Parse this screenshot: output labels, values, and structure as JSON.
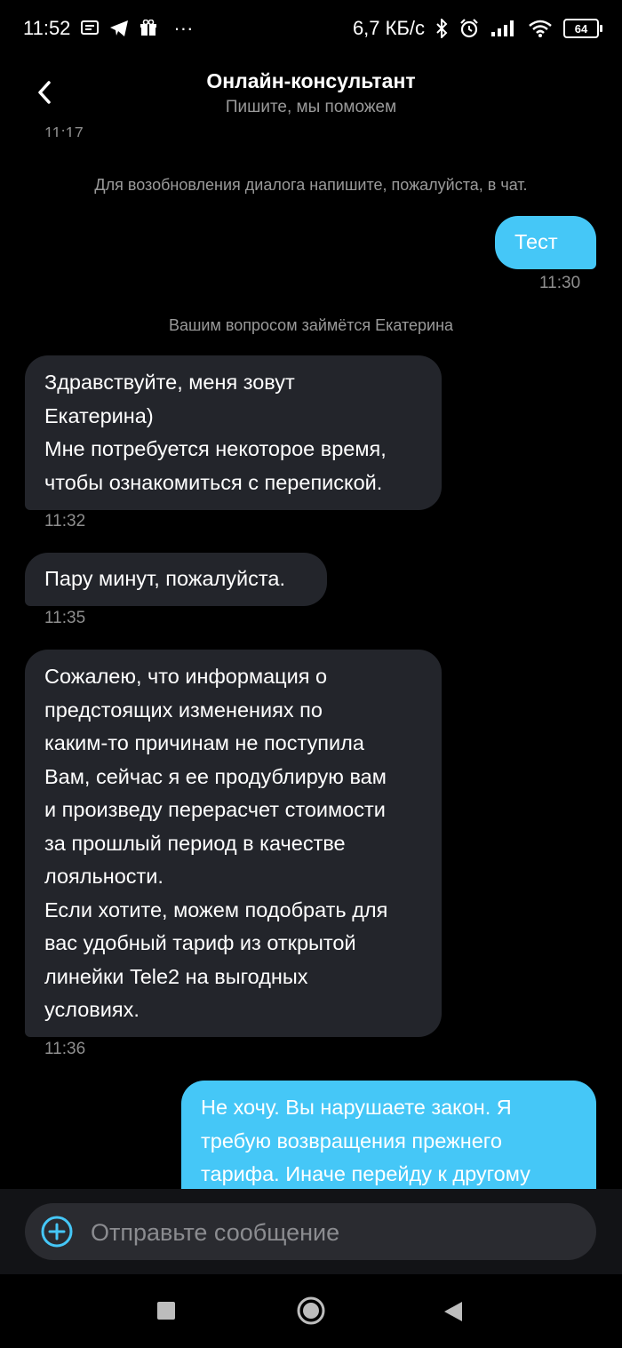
{
  "status_bar": {
    "time": "11:52",
    "more": "···",
    "net_speed": "6,7 КБ/с",
    "battery": "64"
  },
  "header": {
    "title": "Онлайн-консультант",
    "subtitle": "Пишите, мы поможем"
  },
  "chat": {
    "cut_time": "11:17",
    "system_1": "Для возобновления диалога напишите, пожалуйста, в чат.",
    "system_2": "Вашим вопросом займётся Екатерина",
    "messages": [
      {
        "from": "user",
        "text": "Тест",
        "time": "11:30"
      },
      {
        "from": "operator",
        "lines": [
          "Здравствуйте, меня зовут",
          "Екатерина)",
          "Мне потребуется некоторое время,",
          "чтобы ознакомиться с перепиской."
        ],
        "time": "11:32"
      },
      {
        "from": "operator",
        "lines": [
          "Пару минут, пожалуйста."
        ],
        "time": "11:35"
      },
      {
        "from": "operator",
        "lines": [
          "Сожалею, что информация о",
          "предстоящих изменениях по",
          "каким-то причинам не поступила",
          "Вам, сейчас я ее продублирую вам",
          "и произведу перерасчет стоимости",
          "за прошлый период в качестве",
          "лояльности.",
          "Если хотите, можем подобрать для",
          "вас удобный тариф из открытой",
          "линейки Tele2 на выгодных",
          "условиях."
        ],
        "time": "11:36"
      },
      {
        "from": "user",
        "lines": [
          "Не хочу. Вы нарушаете закон. Я",
          "требую возвращения прежнего",
          "тарифа. Иначе перейду к другому"
        ]
      }
    ]
  },
  "composer": {
    "placeholder": "Отправьте сообщение"
  },
  "colors": {
    "background": "#000000",
    "incoming_bubble": "#23252b",
    "outgoing_bubble": "#45c7f7",
    "accent": "#45c7f7"
  }
}
